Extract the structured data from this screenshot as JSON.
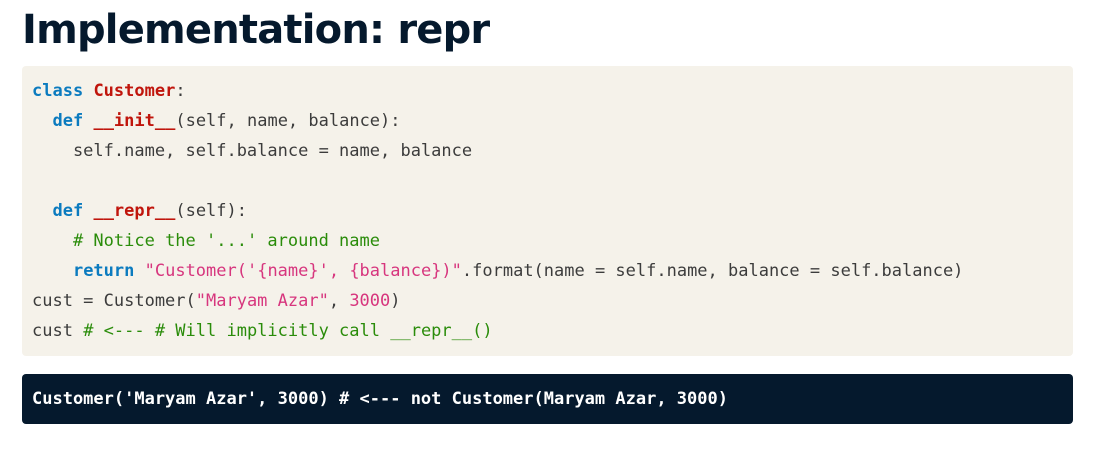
{
  "title": "Implementation: repr",
  "code": {
    "line1": {
      "kw": "class",
      "sp": " ",
      "name": "Customer",
      "rest": ":"
    },
    "line2": {
      "indent": "  ",
      "kw": "def",
      "sp": " ",
      "name": "__init__",
      "rest": "(self, name, balance):"
    },
    "line3": {
      "text": "    self.name, self.balance = name, balance"
    },
    "line4": {
      "text": ""
    },
    "line5": {
      "indent": "  ",
      "kw": "def",
      "sp": " ",
      "name": "__repr__",
      "rest": "(self):"
    },
    "line6": {
      "indent": "    ",
      "comment": "# Notice the '...' around name"
    },
    "line7": {
      "indent": "    ",
      "kw": "return",
      "sp": " ",
      "str": "\"Customer('{name}', {balance})\"",
      "rest": ".format(name = self.name, balance = self.balance)"
    },
    "line8": {
      "pre": "cust = Customer(",
      "str": "\"Maryam Azar\"",
      "mid": ", ",
      "num": "3000",
      "post": ")"
    },
    "line9": {
      "pre": "cust ",
      "comment": "# <--- # Will implicitly call __repr__()"
    }
  },
  "output": {
    "text": "Customer('Maryam Azar', 3000) # <--- not Customer(Maryam Azar, 3000)"
  },
  "colors": {
    "background": "#ffffff",
    "title": "#05192d",
    "code_background": "#f5f2ea",
    "keyword": "#0b7bbf",
    "class_name": "#c0150c",
    "string": "#d7367e",
    "comment": "#2a8c0a",
    "output_background": "#05192d",
    "output_text": "#ffffff"
  }
}
